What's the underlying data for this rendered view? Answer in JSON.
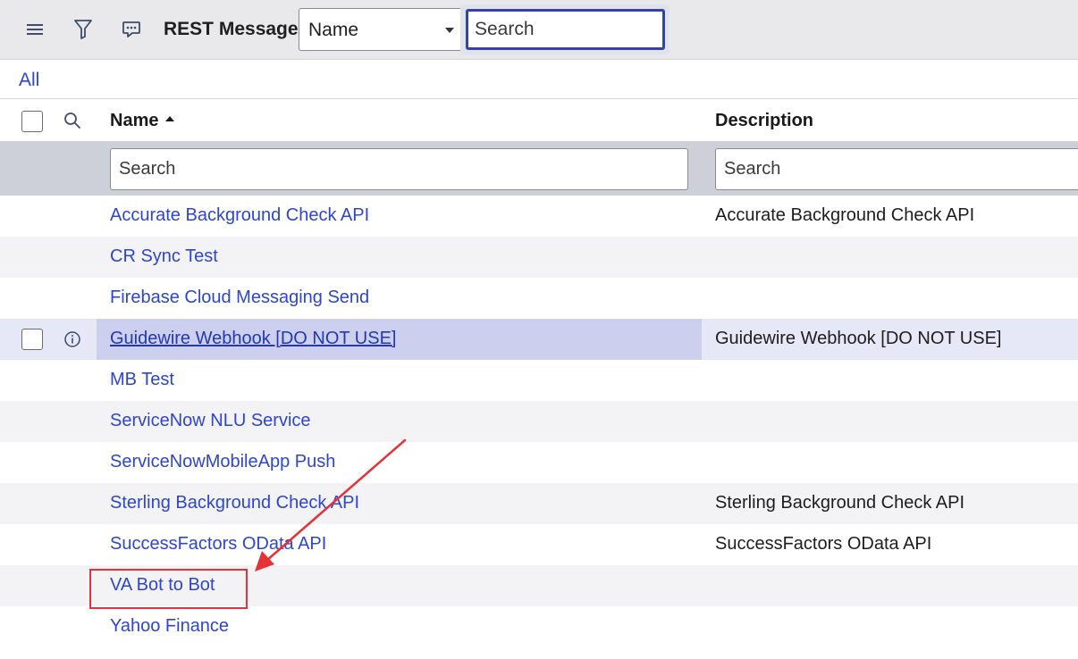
{
  "header": {
    "title": "REST Messages",
    "field_select_value": "Name",
    "search_placeholder": "Search",
    "icons": [
      "hamburger-menu-icon",
      "filter-icon",
      "comment-icon"
    ]
  },
  "breadcrumb": {
    "label": "All"
  },
  "columns": {
    "name": "Name",
    "description": "Description"
  },
  "filters": {
    "name_placeholder": "Search",
    "description_placeholder": "Search"
  },
  "rows": [
    {
      "name": "Accurate Background Check API",
      "description": "Accurate Background Check API"
    },
    {
      "name": "CR Sync Test",
      "description": ""
    },
    {
      "name": "Firebase Cloud Messaging Send",
      "description": ""
    },
    {
      "name": "Guidewire Webhook [DO NOT USE]",
      "description": "Guidewire Webhook [DO NOT USE]"
    },
    {
      "name": "MB Test",
      "description": ""
    },
    {
      "name": "ServiceNow NLU Service",
      "description": ""
    },
    {
      "name": "ServiceNowMobileApp Push",
      "description": ""
    },
    {
      "name": "Sterling Background Check API",
      "description": "Sterling Background Check API"
    },
    {
      "name": "SuccessFactors OData API",
      "description": "SuccessFactors OData API"
    },
    {
      "name": "VA Bot to Bot",
      "description": ""
    },
    {
      "name": "Yahoo Finance",
      "description": ""
    }
  ],
  "colors": {
    "link": "#2d45d4",
    "header_bg": "#e9e9ec",
    "filter_row_bg": "#cdd0d8",
    "hover_row_bg": "#e7e8f7",
    "annotation": "#e53238"
  },
  "annotation": {
    "highlighted_row": "VA Bot to Bot"
  }
}
